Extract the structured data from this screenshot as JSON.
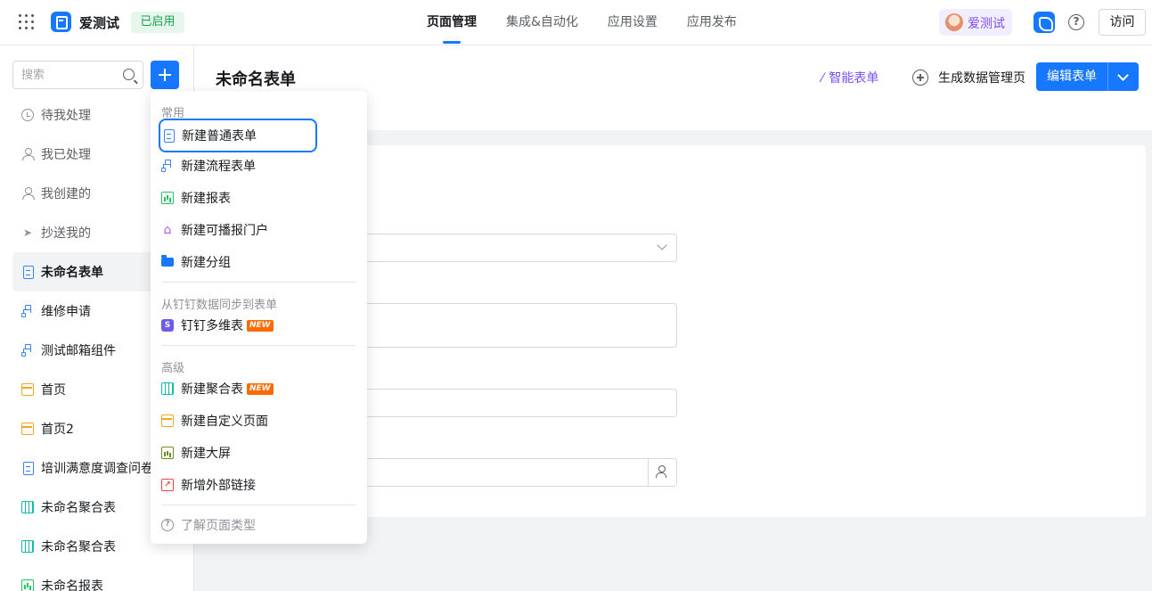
{
  "app": {
    "name": "爱测试",
    "status": "已启用"
  },
  "topnav": {
    "tabs": [
      {
        "label": "页面管理",
        "active": true
      },
      {
        "label": "集成&自动化",
        "active": false
      },
      {
        "label": "应用设置",
        "active": false
      },
      {
        "label": "应用发布",
        "active": false
      }
    ]
  },
  "user": {
    "name": "爱测试"
  },
  "toolbar": {
    "visit_label": "访问",
    "help_glyph": "?"
  },
  "sidebar": {
    "search_placeholder": "搜索",
    "items": [
      {
        "label": "待我处理"
      },
      {
        "label": "我已处理"
      },
      {
        "label": "我创建的"
      },
      {
        "label": "抄送我的"
      },
      {
        "label": "未命名表单"
      },
      {
        "label": "维修申请"
      },
      {
        "label": "测试邮箱组件"
      },
      {
        "label": "首页"
      },
      {
        "label": "首页2"
      },
      {
        "label": "培训满意度调查问卷"
      },
      {
        "label": "未命名聚合表"
      },
      {
        "label": "未命名聚合表"
      },
      {
        "label": "未命名报表"
      }
    ]
  },
  "main": {
    "title": "未命名表单",
    "smart_form_label": "智能表单",
    "generate_label": "生成数据管理页",
    "edit_label": "编辑表单"
  },
  "menu": {
    "groups": {
      "common": "常用",
      "sync": "从钉钉数据同步到表单",
      "advanced": "高级"
    },
    "items": {
      "new_form": "新建普通表单",
      "new_flow": "新建流程表单",
      "new_report": "新建报表",
      "new_portal": "新建可播报门户",
      "new_group": "新建分组",
      "dt_multi": "钉钉多维表",
      "new_agg": "新建聚合表",
      "new_custom": "新建自定义页面",
      "new_screen": "新建大屏",
      "new_link": "新增外部链接",
      "learn_types": "了解页面类型"
    },
    "new_badge": "NEW"
  },
  "colors": {
    "primary": "#1677ff",
    "accent_purple": "#7c4dff",
    "status_green": "#16a34a",
    "new_badge": "#ff6a00"
  },
  "icons": {
    "apps": "grid-icon",
    "search": "search-icon",
    "add": "plus-icon",
    "help": "help-icon"
  }
}
